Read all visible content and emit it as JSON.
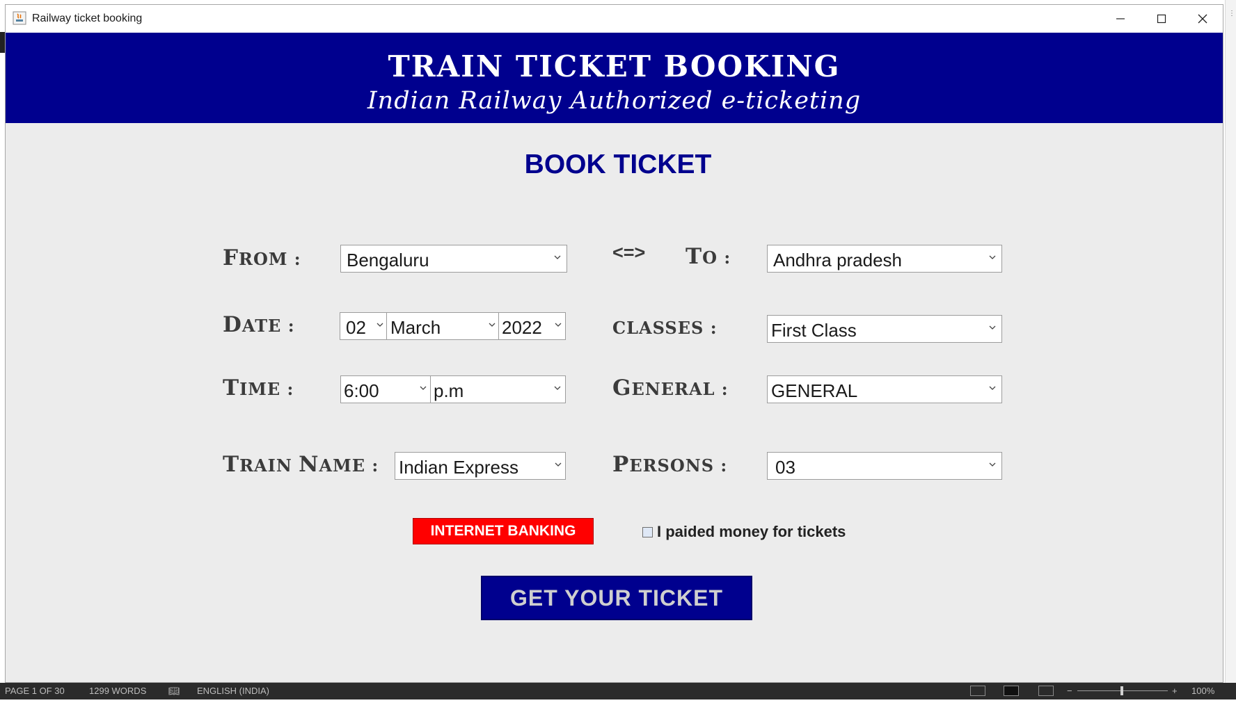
{
  "window": {
    "title": "Railway ticket booking"
  },
  "banner": {
    "title": "TRAIN TICKET BOOKING",
    "subtitle": "Indian Railway Authorized e-ticketing"
  },
  "heading": "BOOK TICKET",
  "form": {
    "from": {
      "label_first": "F",
      "label_rest": "ROM :",
      "value": "Bengaluru"
    },
    "swap_symbol": "<=>",
    "to": {
      "label_first": "T",
      "label_rest": "O :",
      "value": "Andhra pradesh"
    },
    "date": {
      "label_first": "D",
      "label_rest": "ATE :",
      "day": "02",
      "month": "March",
      "year": "2022"
    },
    "classes": {
      "label": "CLASSES :",
      "value": "First Class"
    },
    "time": {
      "label_first": "T",
      "label_rest": "IME :",
      "hour": "6:00",
      "period": "p.m"
    },
    "general": {
      "label_first": "G",
      "label_rest": "ENERAL :",
      "value": "GENERAL"
    },
    "train_name": {
      "label_first": "T",
      "label_mid": "RAIN ",
      "label_first2": "N",
      "label_rest": "AME :",
      "value": "Indian Express"
    },
    "persons": {
      "label_first": "P",
      "label_rest": "ERSONS :",
      "value": "03"
    }
  },
  "payment": {
    "internet_banking": "INTERNET BANKING",
    "paid_checkbox_label": "I paided money for tickets",
    "paid_checked": false
  },
  "submit": "GET YOUR TICKET",
  "statusbar": {
    "page": "PAGE 1 OF 30",
    "words": "1299 WORDS",
    "language": "ENGLISH (INDIA)",
    "zoom": "100%"
  },
  "colors": {
    "banner": "#00008e",
    "heading": "#00008e",
    "internet_banking": "#ff0000",
    "submit": "#00008e"
  }
}
